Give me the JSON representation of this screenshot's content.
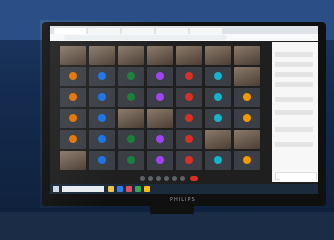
{
  "photo": {
    "subject": "computer-monitor-showing-video-meeting"
  },
  "browser": {
    "tabs": [
      "",
      "",
      "",
      "",
      ""
    ],
    "url": ""
  },
  "meeting": {
    "participants": [
      {
        "name": "",
        "type": "face"
      },
      {
        "name": "",
        "type": "face"
      },
      {
        "name": "",
        "type": "face"
      },
      {
        "name": "",
        "type": "face"
      },
      {
        "name": "",
        "type": "face"
      },
      {
        "name": "",
        "type": "face"
      },
      {
        "name": "",
        "type": "face"
      },
      {
        "name": "",
        "type": "avatar"
      },
      {
        "name": "",
        "type": "avatar"
      },
      {
        "name": "",
        "type": "avatar"
      },
      {
        "name": "",
        "type": "avatar"
      },
      {
        "name": "",
        "type": "avatar"
      },
      {
        "name": "",
        "type": "avatar"
      },
      {
        "name": "",
        "type": "face"
      },
      {
        "name": "",
        "type": "avatar"
      },
      {
        "name": "",
        "type": "avatar"
      },
      {
        "name": "",
        "type": "avatar"
      },
      {
        "name": "",
        "type": "avatar"
      },
      {
        "name": "",
        "type": "avatar"
      },
      {
        "name": "",
        "type": "avatar"
      },
      {
        "name": "",
        "type": "avatar"
      },
      {
        "name": "",
        "type": "avatar"
      },
      {
        "name": "",
        "type": "avatar"
      },
      {
        "name": "",
        "type": "face"
      },
      {
        "name": "",
        "type": "face"
      },
      {
        "name": "",
        "type": "avatar"
      },
      {
        "name": "",
        "type": "avatar"
      },
      {
        "name": "",
        "type": "avatar"
      },
      {
        "name": "",
        "type": "avatar"
      },
      {
        "name": "",
        "type": "avatar"
      },
      {
        "name": "",
        "type": "avatar"
      },
      {
        "name": "",
        "type": "avatar"
      },
      {
        "name": "",
        "type": "avatar"
      },
      {
        "name": "",
        "type": "face"
      },
      {
        "name": "",
        "type": "face"
      },
      {
        "name": "",
        "type": "face"
      },
      {
        "name": "",
        "type": "avatar"
      },
      {
        "name": "",
        "type": "avatar"
      },
      {
        "name": "",
        "type": "avatar"
      },
      {
        "name": "",
        "type": "avatar"
      },
      {
        "name": "",
        "type": "avatar"
      },
      {
        "name": "",
        "type": "avatar"
      }
    ],
    "avatar_colors": [
      "#e37400",
      "#1a73e8",
      "#188038",
      "#a142f4",
      "#d93025",
      "#12b5cb",
      "#f29900"
    ],
    "time_label": "",
    "chat_title": "",
    "end_call_color": "#d93025"
  },
  "taskbar": {
    "search_placeholder": "",
    "icon_colors": [
      "#f2c14e",
      "#2f80ed",
      "#e04f5f",
      "#34a853",
      "#fbbc05"
    ]
  }
}
